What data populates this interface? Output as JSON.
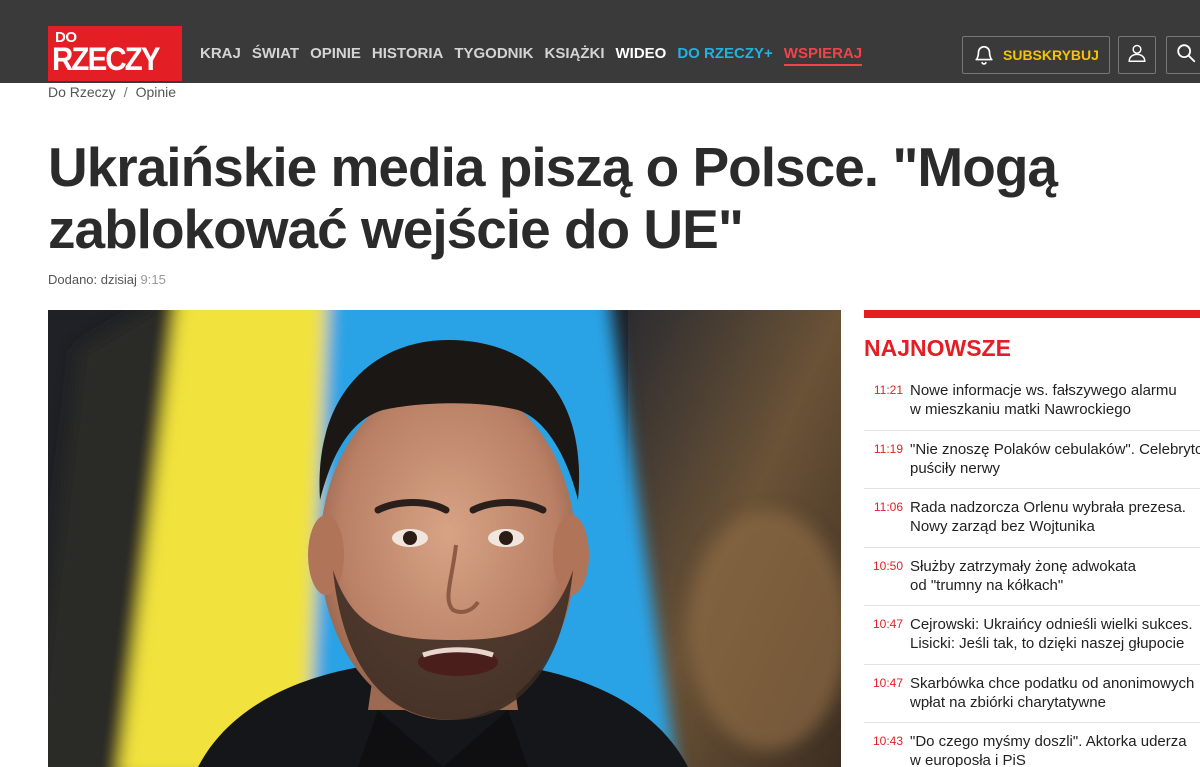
{
  "header": {
    "logo_top": "DO",
    "logo_bottom": "RZECZY",
    "nav": [
      {
        "label": "KRAJ"
      },
      {
        "label": "ŚWIAT"
      },
      {
        "label": "OPINIE"
      },
      {
        "label": "HISTORIA"
      },
      {
        "label": "TYGODNIK"
      },
      {
        "label": "KSIĄŻKI"
      },
      {
        "label": "WIDEO"
      },
      {
        "label": "DO RZECZY+"
      },
      {
        "label": "WSPIERAJ"
      }
    ],
    "subscribe_label": "SUBSKRYBUJ"
  },
  "breadcrumb": [
    {
      "label": "Do Rzeczy"
    },
    {
      "label": "Opinie"
    }
  ],
  "breadcrumb_sep": "/",
  "article": {
    "title": "Ukraińskie media piszą o Polsce. \"Mogą zablokować wejście do UE\"",
    "added_label": "Dodano: dzisiaj",
    "added_time": "9:15"
  },
  "sidebar": {
    "heading": "NAJNOWSZE",
    "items": [
      {
        "time": "11:21",
        "line1": "Nowe informacje ws. fałszywego alarmu",
        "line2": "w mieszkaniu matki Nawrockiego"
      },
      {
        "time": "11:19",
        "line1": "\"Nie znoszę Polaków cebulaków\". Celebrytce",
        "line2": "puściły nerwy"
      },
      {
        "time": "11:06",
        "line1": "Rada nadzorcza Orlenu wybrała prezesa.",
        "line2": "Nowy zarząd bez Wojtunika"
      },
      {
        "time": "10:50",
        "line1": "Służby zatrzymały żonę adwokata",
        "line2": "od \"trumny na kółkach\""
      },
      {
        "time": "10:47",
        "line1": "Cejrowski: Ukraińcy odnieśli wielki sukces.",
        "line2": "Lisicki: Jeśli tak, to dzięki naszej głupocie"
      },
      {
        "time": "10:47",
        "line1": "Skarbówka chce podatku od anonimowych",
        "line2": "wpłat na zbiórki charytatywne"
      },
      {
        "time": "10:43",
        "line1": "\"Do czego myśmy doszli\". Aktorka uderza",
        "line2": "w europosła i PiS"
      }
    ]
  },
  "colors": {
    "brand_red": "#e31e24",
    "topbar": "#3a3a3a",
    "subscribe_yellow": "#f5c300",
    "plus_blue": "#20b3e0"
  },
  "icons": {
    "subscribe": "bell-icon",
    "user": "user-icon",
    "search": "search-icon"
  }
}
